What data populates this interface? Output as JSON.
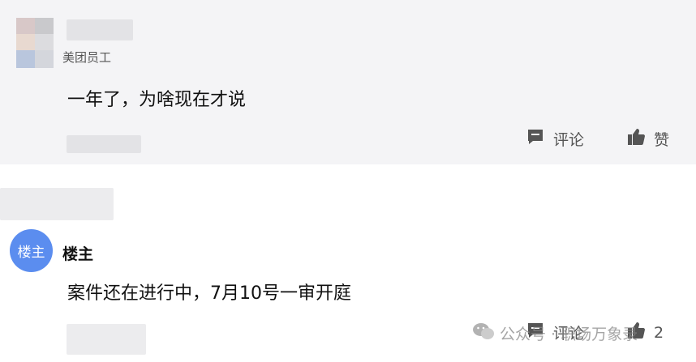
{
  "comment1": {
    "role_label": "美团员工",
    "text": "一年了，为啥现在才说",
    "comment_label": "评论",
    "like_label": "赞"
  },
  "comment2": {
    "avatar_label": "楼主",
    "author": "楼主",
    "text": "案件还在进行中，7月10号一审开庭",
    "comment_label": "评论",
    "like_count": "2"
  },
  "watermark": {
    "text": "公众号 · 职场万象录"
  },
  "colors": {
    "avatar_blue": "#5b8def",
    "card_bg": "#f4f4f6",
    "icon_gray": "#555555"
  }
}
